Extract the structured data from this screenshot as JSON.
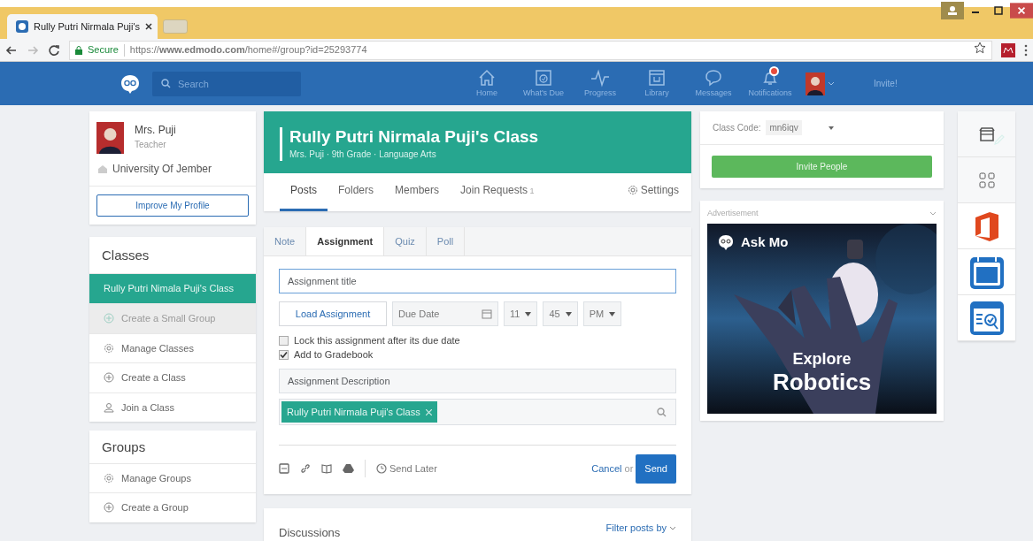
{
  "browser": {
    "tab_title": "Rully Putri Nirmala Puji's",
    "secure": "Secure",
    "url": "https://**www.edmodo.com**/home#/group?id=25293774"
  },
  "nav": {
    "search_placeholder": "Search",
    "items": [
      {
        "kind": "home",
        "label": "Home"
      },
      {
        "kind": "due",
        "label": "What's Due"
      },
      {
        "kind": "progress",
        "label": "Progress"
      },
      {
        "kind": "library",
        "label": "Library"
      },
      {
        "kind": "messages",
        "label": "Messages"
      },
      {
        "kind": "notifications",
        "label": "Notifications",
        "alert": true
      }
    ],
    "invite": "Invite!"
  },
  "profile": {
    "name": "Mrs. Puji",
    "role": "Teacher",
    "school": "University Of Jember",
    "button": "Improve My Profile"
  },
  "classes": {
    "heading": "Classes",
    "items": [
      {
        "kind": "class",
        "label": "Rully Putri Nimala Puji's Class",
        "selected": true,
        "disabled": false
      },
      {
        "kind": "add",
        "label": "Create a Small Group",
        "selected": false,
        "disabled": true
      },
      {
        "kind": "gear",
        "label": "Manage Classes",
        "selected": false,
        "disabled": false
      },
      {
        "kind": "add",
        "label": "Create a Class",
        "selected": false,
        "disabled": false
      },
      {
        "kind": "join",
        "label": "Join a Class",
        "selected": false,
        "disabled": false
      }
    ]
  },
  "groups": {
    "heading": "Groups",
    "items": [
      {
        "kind": "gear",
        "label": "Manage Groups"
      },
      {
        "kind": "add",
        "label": "Create a Group"
      }
    ]
  },
  "class_header": {
    "title": "Rully Putri Nirmala Puji's Class",
    "subtitle": "Mrs. Puji · 9th Grade · Language Arts",
    "tabs": [
      {
        "label": "Posts",
        "selected": true
      },
      {
        "label": "Folders",
        "selected": false
      },
      {
        "label": "Members",
        "selected": false
      },
      {
        "label": "Join Requests",
        "count": "1",
        "selected": false
      }
    ],
    "settings": "Settings"
  },
  "composer": {
    "tabs": [
      {
        "label": "Note",
        "selected": false
      },
      {
        "label": "Assignment",
        "selected": true
      },
      {
        "label": "Quiz",
        "selected": false
      },
      {
        "label": "Poll",
        "selected": false
      }
    ],
    "title_placeholder": "Assignment title",
    "load_button": "Load Assignment",
    "due_placeholder": "Due Date",
    "hour": "11",
    "minute": "45",
    "ampm": "PM",
    "checkboxes": [
      {
        "label": "Lock this assignment after its due date",
        "checked": false
      },
      {
        "label": "Add to Gradebook",
        "checked": true
      }
    ],
    "description_placeholder": "Assignment Description",
    "recipient": "Rully Putri Nirmala Puji's Class",
    "send_later": "Send Later",
    "cancel": "Cancel",
    "or": "or",
    "send": "Send"
  },
  "discussions": {
    "title": "Discussions",
    "filter": "Filter posts by"
  },
  "class_code": {
    "label": "Class Code:",
    "code": "mn6iqv",
    "invite_button": "Invite People"
  },
  "ad": {
    "label": "Advertisement",
    "brand": "Ask Mo",
    "line_1": "Explore",
    "line_2": "Robotics"
  }
}
